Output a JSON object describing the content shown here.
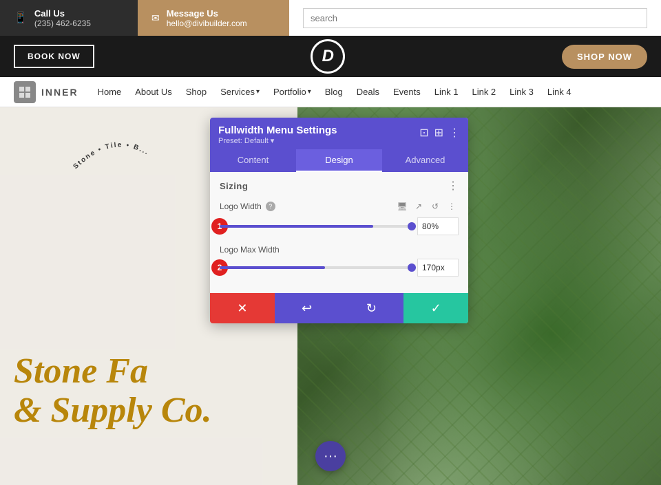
{
  "topbar": {
    "call_icon": "📱",
    "call_title": "Call Us",
    "call_number": "(235) 462-6235",
    "message_icon": "✉",
    "message_title": "Message Us",
    "message_email": "hello@divibuilder.com",
    "search_placeholder": "search"
  },
  "header": {
    "book_label": "BOOK NOW",
    "logo_letter": "D",
    "shop_label": "SHOP NOW"
  },
  "nav": {
    "logo_text": "INNER",
    "items": [
      {
        "label": "Home",
        "dropdown": false
      },
      {
        "label": "About Us",
        "dropdown": false
      },
      {
        "label": "Shop",
        "dropdown": false
      },
      {
        "label": "Services",
        "dropdown": true
      },
      {
        "label": "Portfolio",
        "dropdown": true
      },
      {
        "label": "Blog",
        "dropdown": false
      },
      {
        "label": "Deals",
        "dropdown": false
      },
      {
        "label": "Events",
        "dropdown": false
      },
      {
        "label": "Link 1",
        "dropdown": false
      },
      {
        "label": "Link 2",
        "dropdown": false
      },
      {
        "label": "Link 3",
        "dropdown": false
      },
      {
        "label": "Link 4",
        "dropdown": false
      }
    ]
  },
  "settings_panel": {
    "title": "Fullwidth Menu Settings",
    "preset_label": "Preset: Default",
    "tabs": [
      {
        "label": "Content",
        "active": false
      },
      {
        "label": "Design",
        "active": true
      },
      {
        "label": "Advanced",
        "active": false
      }
    ],
    "section_sizing": "Sizing",
    "logo_width_label": "Logo Width",
    "logo_width_value": "80%",
    "logo_width_percent": 80,
    "logo_max_width_label": "Logo Max Width",
    "logo_max_width_value": "170px",
    "logo_max_width_percent": 55,
    "badge1": "1",
    "badge2": "2"
  },
  "footer_buttons": {
    "cancel": "✕",
    "undo": "↩",
    "redo": "↻",
    "confirm": "✓"
  },
  "stone_text": {
    "curved": "Stone • Tile • B...",
    "title_line1": "Stone Fa",
    "title_line2": "& Supply Co."
  },
  "fab": {
    "icon": "•••"
  }
}
